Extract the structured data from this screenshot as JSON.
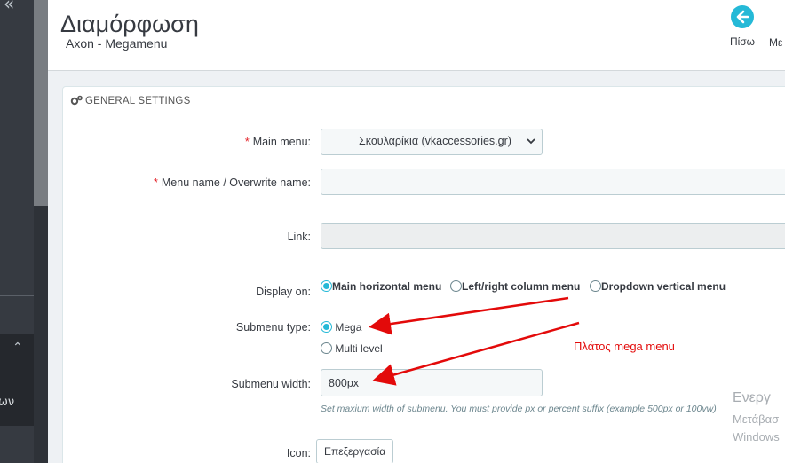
{
  "header": {
    "title": "Διαμόρφωση",
    "subtitle": "Axon - Megamenu",
    "back_label": "Πίσω",
    "more_label": "Με"
  },
  "panel": {
    "heading": "GENERAL SETTINGS"
  },
  "form": {
    "main_menu_label": "Main menu:",
    "main_menu_value": "Σκουλαρίκια (vkaccessories.gr)",
    "menu_name_label": "Menu name / Overwrite name:",
    "menu_name_value": "",
    "link_label": "Link:",
    "link_value": "",
    "display_on_label": "Display on:",
    "display_on_options": [
      "Main horizontal menu",
      "Left/right column menu",
      "Dropdown vertical menu"
    ],
    "display_on_selected": "Main horizontal menu",
    "submenu_type_label": "Submenu type:",
    "submenu_type_options": [
      "Mega",
      "Multi level"
    ],
    "submenu_type_selected": "Mega",
    "submenu_width_label": "Submenu width:",
    "submenu_width_value": "800px",
    "submenu_width_help": "Set maxium width of submenu. You must provide px or percent suffix (example 500px or 100vw)",
    "icon_label": "Icon:",
    "icon_button": "Επεξεργασία"
  },
  "annotation": {
    "text": "Πλάτος mega menu",
    "color": "#e30a0a"
  },
  "watermark": {
    "line1": "Ενεργ",
    "line2": "Μετάβασ",
    "line3": "Windows"
  },
  "sidebar": {
    "cut_label": "ων"
  },
  "colors": {
    "accent": "#25b9d7",
    "required": "#e32128",
    "sidebar": "#363a41"
  }
}
